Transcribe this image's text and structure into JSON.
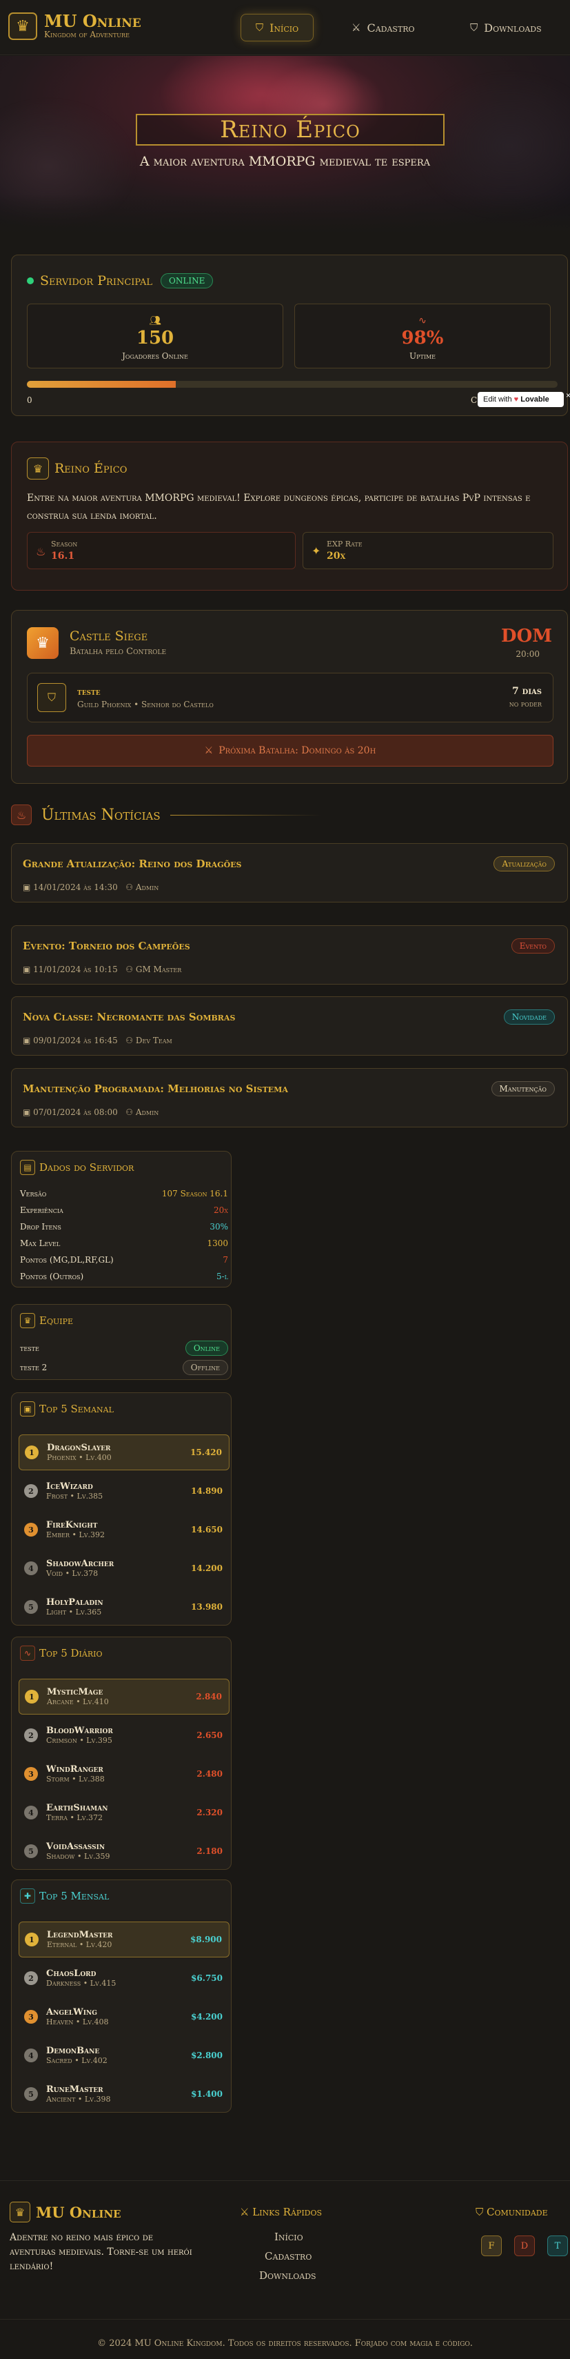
{
  "header": {
    "logo_title": "MU Online",
    "logo_subtitle": "Kingdom of Adventure",
    "nav": [
      {
        "label": "Início",
        "icon": "shield-icon"
      },
      {
        "label": "Cadastro",
        "icon": "sword-icon"
      },
      {
        "label": "Downloads",
        "icon": "shield-icon"
      }
    ]
  },
  "hero": {
    "title": "Reino Épico",
    "subtitle": "A maior aventura MMORPG medieval te espera"
  },
  "server": {
    "title": "Servidor Principal",
    "status": "ONLINE",
    "players_value": "150",
    "players_label": "Jogadores Online",
    "uptime_value": "98%",
    "uptime_label": "Uptime",
    "bar_fraction": 0.28,
    "bar_min": "0",
    "bar_max": "C",
    "edit_badge": "Edit with",
    "edit_brand": "Lovable"
  },
  "intro": {
    "title": "Reino Épico",
    "text": "Entre na maior aventura MMORPG medieval! Explore dungeons épicas, participe de batalhas PvP intensas e construa sua lenda imortal.",
    "season_label": "Season",
    "season_value": "16.1",
    "exp_label": "EXP Rate",
    "exp_value": "20x"
  },
  "castle": {
    "title": "Castle Siege",
    "subtitle": "Batalha pelo Controle",
    "day": "DOM",
    "time": "20:00",
    "owner": "teste",
    "owner_sub": "Guild Phoenix • Senhor do Castelo",
    "days": "7 dias",
    "days_label": "no poder",
    "next_battle": "Próxima Batalha: Domingo às 20h"
  },
  "news_title": "Últimas Notícias",
  "news": [
    {
      "title": "Grande Atualização: Reino dos Dragões",
      "date": "14/01/2024 às 14:30",
      "author": "Admin",
      "tag": "Atualização"
    },
    {
      "title": "Evento: Torneio dos Campeões",
      "date": "11/01/2024 às 10:15",
      "author": "GM Master",
      "tag": "Evento"
    },
    {
      "title": "Nova Classe: Necromante das Sombras",
      "date": "09/01/2024 às 16:45",
      "author": "Dev Team",
      "tag": "Novidade"
    },
    {
      "title": "Manutenção Programada: Melhorias no Sistema",
      "date": "07/01/2024 às 08:00",
      "author": "Admin",
      "tag": "Manutenção"
    }
  ],
  "server_data": {
    "title": "Dados do Servidor",
    "rows": [
      {
        "k": "Versão",
        "v": "107 Season 16.1"
      },
      {
        "k": "Experiência",
        "v": "20x"
      },
      {
        "k": "Drop Itens",
        "v": "30%"
      },
      {
        "k": "Max Level",
        "v": "1300"
      },
      {
        "k": "Pontos (MG,DL,RF,GL)",
        "v": "7"
      },
      {
        "k": "Pontos (Outros)",
        "v": "5-l"
      }
    ]
  },
  "team": {
    "title": "Equipe",
    "members": [
      {
        "name": "teste",
        "status": "Online"
      },
      {
        "name": "teste 2",
        "status": "Offline"
      }
    ]
  },
  "top_weekly": {
    "title": "Top 5 Semanal",
    "rows": [
      {
        "n": "1",
        "name": "DragonSlayer",
        "sub": "Phoenix • Lv.400",
        "pts": "15.420"
      },
      {
        "n": "2",
        "name": "IceWizard",
        "sub": "Frost • Lv.385",
        "pts": "14.890"
      },
      {
        "n": "3",
        "name": "FireKnight",
        "sub": "Ember • Lv.392",
        "pts": "14.650"
      },
      {
        "n": "4",
        "name": "ShadowArcher",
        "sub": "Void • Lv.378",
        "pts": "14.200"
      },
      {
        "n": "5",
        "name": "HolyPaladin",
        "sub": "Light • Lv.365",
        "pts": "13.980"
      }
    ]
  },
  "top_daily": {
    "title": "Top 5 Diário",
    "rows": [
      {
        "n": "1",
        "name": "MysticMage",
        "sub": "Arcane • Lv.410",
        "pts": "2.840"
      },
      {
        "n": "2",
        "name": "BloodWarrior",
        "sub": "Crimson • Lv.395",
        "pts": "2.650"
      },
      {
        "n": "3",
        "name": "WindRanger",
        "sub": "Storm • Lv.388",
        "pts": "2.480"
      },
      {
        "n": "4",
        "name": "EarthShaman",
        "sub": "Terra • Lv.372",
        "pts": "2.320"
      },
      {
        "n": "5",
        "name": "VoidAssassin",
        "sub": "Shadow • Lv.359",
        "pts": "2.180"
      }
    ]
  },
  "top_monthly": {
    "title": "Top 5 Mensal",
    "rows": [
      {
        "n": "1",
        "name": "LegendMaster",
        "sub": "Eternal • Lv.420",
        "pts": "$8.900"
      },
      {
        "n": "2",
        "name": "ChaosLord",
        "sub": "Darkness • Lv.415",
        "pts": "$6.750"
      },
      {
        "n": "3",
        "name": "AngelWing",
        "sub": "Heaven • Lv.408",
        "pts": "$4.200"
      },
      {
        "n": "4",
        "name": "DemonBane",
        "sub": "Sacred • Lv.402",
        "pts": "$2.800"
      },
      {
        "n": "5",
        "name": "RuneMaster",
        "sub": "Ancient • Lv.398",
        "pts": "$1.400"
      }
    ]
  },
  "footer": {
    "brand": "MU Online",
    "about": "Adentre no reino mais épico de aventuras medievais. Torne-se um herói lendário!",
    "links_title": "Links Rápidos",
    "links": [
      "Início",
      "Cadastro",
      "Downloads"
    ],
    "community_title": "Comunidade",
    "community": [
      "F",
      "D",
      "T"
    ],
    "copyright": "© 2024 MU Online Kingdom. Todos os direitos reservados. Forjado com magia e código."
  }
}
